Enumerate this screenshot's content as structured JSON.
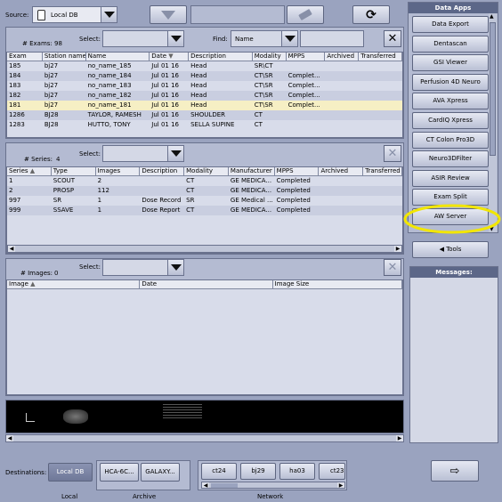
{
  "source": {
    "label": "Source:",
    "value": "Local DB"
  },
  "exams": {
    "count_label": "# Exams:",
    "count": "98",
    "select_label": "Select:",
    "find_label": "Find:",
    "find_field": "Name",
    "columns": [
      "Exam",
      "Station name",
      "Name",
      "Date",
      "Description",
      "Modality",
      "MPPS",
      "Archived",
      "Transferred"
    ],
    "rows": [
      [
        "185",
        "bj27",
        "no_name_185",
        "Jul 01 16",
        "Head",
        "SR\\CT",
        "",
        "",
        ""
      ],
      [
        "184",
        "bj27",
        "no_name_184",
        "Jul 01 16",
        "Head",
        "CT\\SR",
        "Complet...",
        "",
        ""
      ],
      [
        "183",
        "bj27",
        "no_name_183",
        "Jul 01 16",
        "Head",
        "CT\\SR",
        "Complet...",
        "",
        ""
      ],
      [
        "182",
        "bj27",
        "no_name_182",
        "Jul 01 16",
        "Head",
        "CT\\SR",
        "Complet...",
        "",
        ""
      ],
      [
        "181",
        "bj27",
        "no_name_181",
        "Jul 01 16",
        "Head",
        "CT\\SR",
        "Complet...",
        "",
        ""
      ],
      [
        "1286",
        "BJ28",
        "TAYLOR, RAMESH",
        "Jul 01 16",
        "SHOULDER",
        "CT",
        "",
        "",
        ""
      ],
      [
        "1283",
        "BJ28",
        "HUTTO, TONY",
        "Jul 01 16",
        "SELLA SUPINE",
        "CT",
        "",
        "",
        ""
      ]
    ]
  },
  "series": {
    "count_label": "# Series:",
    "count": "4",
    "select_label": "Select:",
    "columns": [
      "Series",
      "Type",
      "Images",
      "Description",
      "Modality",
      "Manufacturer",
      "MPPS",
      "Archived",
      "Transferred ..."
    ],
    "rows": [
      [
        "1",
        "SCOUT",
        "2",
        "",
        "CT",
        "GE MEDICA...",
        "Completed",
        "",
        ""
      ],
      [
        "2",
        "PROSP",
        "112",
        "",
        "CT",
        "GE MEDICA...",
        "Completed",
        "",
        ""
      ],
      [
        "997",
        "SR",
        "1",
        "Dose Record",
        "SR",
        "GE Medical ...",
        "Completed",
        "",
        ""
      ],
      [
        "999",
        "SSAVE",
        "1",
        "Dose Report",
        "CT",
        "GE MEDICA...",
        "Completed",
        "",
        ""
      ]
    ]
  },
  "images": {
    "count_label": "# Images:",
    "count": "0",
    "select_label": "Select:",
    "columns": [
      "Image",
      "Date",
      "Image Size"
    ]
  },
  "data_apps": {
    "title": "Data Apps",
    "items": [
      "Data Export",
      "Dentascan",
      "GSI Viewer",
      "Perfusion 4D Neuro",
      "AVA Xpress",
      "CardIQ Xpress",
      "CT Colon Pro3D",
      "Neuro3DFilter",
      "ASIR Review",
      "Exam Split",
      "AW Server"
    ]
  },
  "tools_label": "Tools",
  "messages_title": "Messages:",
  "destinations": {
    "label": "Destinations:",
    "local_button": "Local DB",
    "local_group": "Local",
    "archive_buttons": [
      "HCA-6C...",
      "GALAXY..."
    ],
    "archive_group": "Archive",
    "network_buttons": [
      "ct24",
      "bj29",
      "ha03",
      "ct23"
    ],
    "network_group": "Network"
  },
  "colors": {
    "background": "#9aa3bf",
    "selected_row": "#f6efc4",
    "highlight_circle": "#f2e600"
  }
}
